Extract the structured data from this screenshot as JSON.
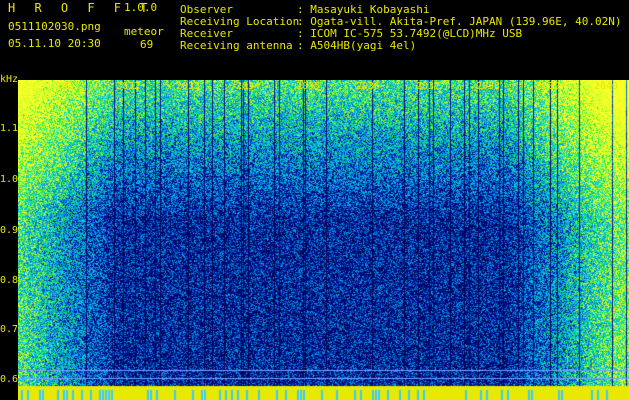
{
  "header": {
    "app_title": "H R O F F T",
    "app_version": "1.0.0",
    "filename": "0511102030.png",
    "datetime": "05.11.10 20:30",
    "meteor_label": "meteor",
    "meteor_count": "69"
  },
  "meta": [
    {
      "label": "Observer",
      "value": ": Masayuki Kobayashi"
    },
    {
      "label": "Receiving Location",
      "value": ": Ogata-vill. Akita-Pref. JAPAN (139.96E, 40.02N)"
    },
    {
      "label": "Receiver",
      "value": ": ICOM IC-575 53.7492(@LCD)MHz USB"
    },
    {
      "label": "Receiving antenna",
      "value": ": A504HB(yagi 4el)"
    }
  ],
  "axis": {
    "y_unit": "kHz",
    "y_ticks": [
      "1.1",
      "1.0",
      "0.9",
      "0.8",
      "0.7",
      "0.6"
    ],
    "x_ticks": [
      "2031",
      "2032",
      "2033",
      "2034",
      "2035",
      "2036",
      "2037",
      "2038",
      "2039",
      "2040"
    ]
  },
  "colors": {
    "background": "#000000",
    "text_yellow": "#e8e800",
    "text_green": "#33ff33",
    "noise_low": "#0a1a8c",
    "noise_high": "#33ff33"
  }
}
